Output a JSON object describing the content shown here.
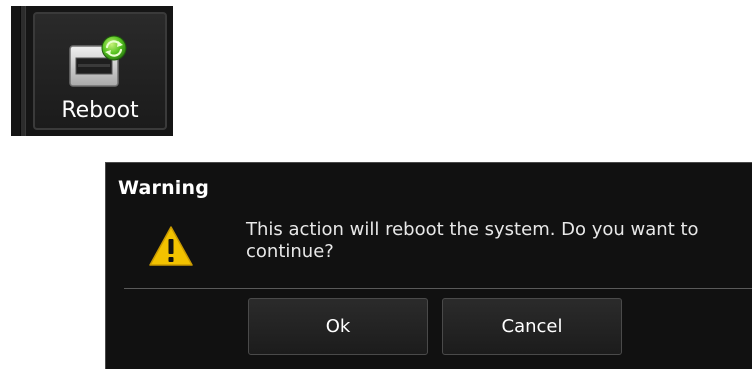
{
  "toolbar": {
    "reboot_label": "Reboot",
    "reboot_icon": "reboot-icon"
  },
  "dialog": {
    "title": "Warning",
    "icon": "warning-icon",
    "message_line1": "This action will reboot the system. Do you want to",
    "message_line2": "continue?",
    "ok_label": "Ok",
    "cancel_label": "Cancel"
  },
  "colors": {
    "background": "#111111",
    "warning_yellow": "#f2c200",
    "refresh_green": "#44b52a"
  }
}
